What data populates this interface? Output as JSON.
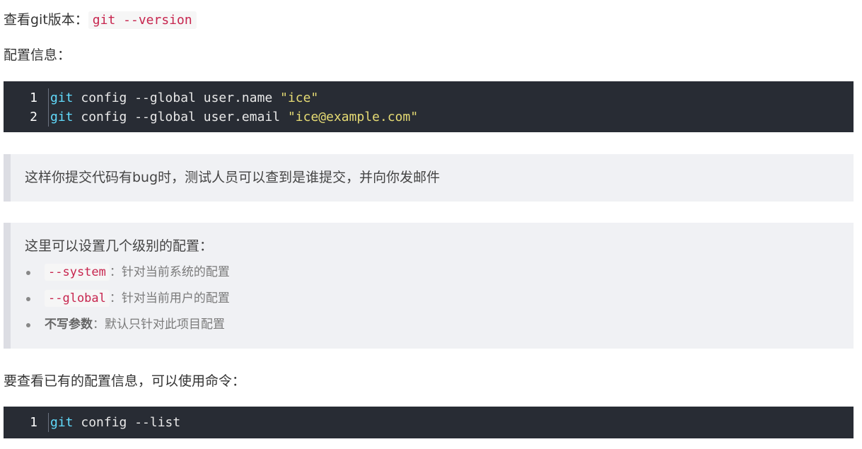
{
  "para_version": {
    "prefix": "查看git版本：",
    "code": "git --version"
  },
  "para_config": "配置信息：",
  "code_block_1": {
    "lines": [
      {
        "num": "1",
        "cmd": "git",
        "args": " config --global user.name ",
        "str": "\"ice\""
      },
      {
        "num": "2",
        "cmd": "git",
        "args": " config --global user.email ",
        "str": "\"ice@example.com\""
      }
    ]
  },
  "quote_1": "这样你提交代码有bug时，测试人员可以查到是谁提交，并向你发邮件",
  "quote_2": {
    "title": "这里可以设置几个级别的配置：",
    "items": [
      {
        "code": "--system",
        "text": "：针对当前系统的配置"
      },
      {
        "code": "--global",
        "text": "：针对当前用户的配置"
      },
      {
        "bold": "不写参数",
        "text": "：默认只针对此项目配置"
      }
    ]
  },
  "para_list": "要查看已有的配置信息，可以使用命令：",
  "code_block_2": {
    "lines": [
      {
        "num": "1",
        "cmd": "git",
        "args": " config --list"
      }
    ]
  },
  "colors": {
    "code_bg": "#282c34",
    "cmd": "#61dafb",
    "string": "#e6db74",
    "inline_code": "#c7254e",
    "quote_bg": "#f0f1f4"
  }
}
